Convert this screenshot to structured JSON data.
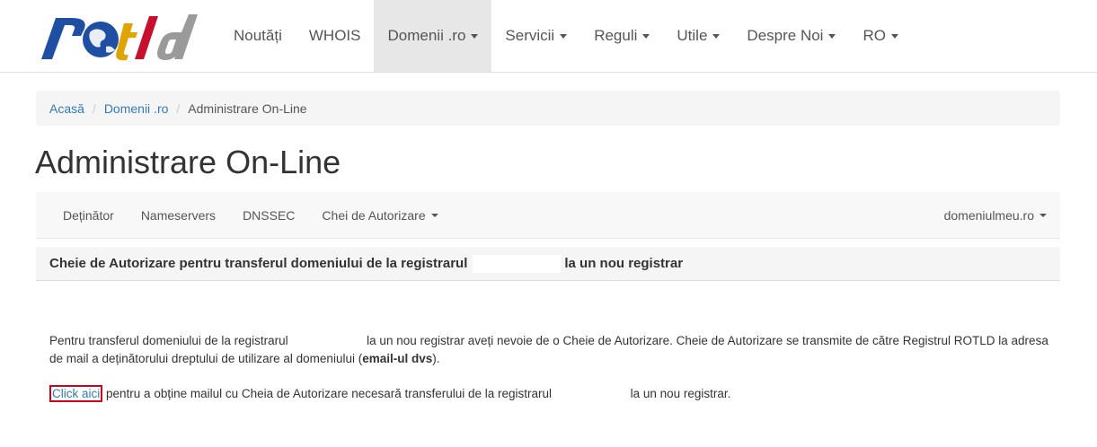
{
  "brand": {
    "logo_text": "rotld",
    "colors": {
      "blue": "#1f4fa3",
      "gold": "#e0a400",
      "red": "#c8102e",
      "grey": "#9a9a9a"
    }
  },
  "nav": {
    "items": [
      {
        "label": "Noutăți",
        "dropdown": false,
        "active": false
      },
      {
        "label": "WHOIS",
        "dropdown": false,
        "active": false
      },
      {
        "label": "Domenii .ro",
        "dropdown": true,
        "active": true
      },
      {
        "label": "Servicii",
        "dropdown": true,
        "active": false
      },
      {
        "label": "Reguli",
        "dropdown": true,
        "active": false
      },
      {
        "label": "Utile",
        "dropdown": true,
        "active": false
      },
      {
        "label": "Despre Noi",
        "dropdown": true,
        "active": false
      },
      {
        "label": "RO",
        "dropdown": true,
        "active": false
      }
    ]
  },
  "breadcrumb": {
    "home": "Acasă",
    "section": "Domenii .ro",
    "current": "Administrare On-Line"
  },
  "page": {
    "title": "Administrare On-Line"
  },
  "subnav": {
    "items": [
      "Deținător",
      "Nameservers",
      "DNSSEC",
      "Chei de Autorizare"
    ],
    "domain": "domeniulmeu.ro"
  },
  "panel": {
    "heading_start": "Cheie de Autorizare pentru transferul domeniului de la registrarul",
    "heading_end": "la un nou registrar"
  },
  "content": {
    "p1_start": "Pentru transferul domeniului de la registrarul",
    "p1_mid": "la un nou registrar aveți nevoie de o Cheie de Autorizare. Cheie de Autorizare se transmite de către Registrul ROTLD la adresa de mail a deținătorului dreptului de utilizare al domeniului (",
    "p1_bold": "email-ul dvs",
    "p1_end": ").",
    "link": "Click aici",
    "p2_mid": "pentru a obține mailul cu Cheia de Autorizare necesară transferului de la registrarul",
    "p2_end": "la un nou registrar."
  }
}
